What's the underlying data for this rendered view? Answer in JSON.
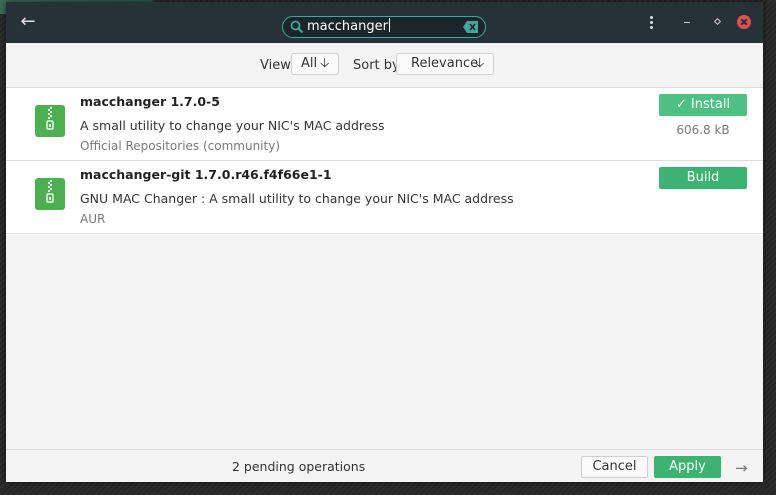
{
  "titlebar": {
    "search_value": "macchanger",
    "back_icon": "←"
  },
  "toolbar": {
    "view_label": "View",
    "view_value": "All",
    "sort_label": "Sort by",
    "sort_value": "Relevance",
    "arrow": "🡣"
  },
  "packages": [
    {
      "name": "macchanger  1.7.0-5",
      "description": "A small utility to change your NIC's MAC address",
      "repo": "Official Repositories (community)",
      "action": "✓ Install",
      "size": "606.8 kB"
    },
    {
      "name": "macchanger-git  1.7.0.r46.f4f66e1-1",
      "description": "GNU MAC Changer : A small utility to change your NIC's MAC address",
      "repo": "AUR",
      "action": "Build",
      "size": ""
    }
  ],
  "statusbar": {
    "pending": "2 pending operations",
    "cancel": "Cancel",
    "apply": "Apply",
    "next": "→"
  },
  "colors": {
    "accent": "#3cb371",
    "titlebar": "#263238",
    "close": "#e0504f"
  }
}
